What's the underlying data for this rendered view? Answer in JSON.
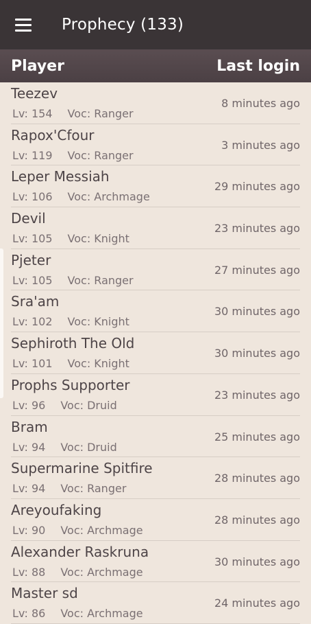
{
  "appbar": {
    "title": "Prophecy (133)",
    "menu_icon": "menu-icon"
  },
  "table": {
    "headers": {
      "player": "Player",
      "last_login": "Last login"
    },
    "rows": [
      {
        "name": "Teezev",
        "level": "Lv: 154",
        "vocation": "Voc: Ranger",
        "last_login": "8 minutes ago"
      },
      {
        "name": "Rapox'Cfour",
        "level": "Lv: 119",
        "vocation": "Voc: Ranger",
        "last_login": "3 minutes ago"
      },
      {
        "name": "Leper Messiah",
        "level": "Lv: 106",
        "vocation": "Voc: Archmage",
        "last_login": "29 minutes ago"
      },
      {
        "name": "Devil",
        "level": "Lv: 105",
        "vocation": "Voc: Knight",
        "last_login": "23 minutes ago"
      },
      {
        "name": "Pjeter",
        "level": "Lv: 105",
        "vocation": "Voc: Ranger",
        "last_login": "27 minutes ago"
      },
      {
        "name": "Sra'am",
        "level": "Lv: 102",
        "vocation": "Voc: Knight",
        "last_login": "30 minutes ago"
      },
      {
        "name": "Sephiroth The Old",
        "level": "Lv: 101",
        "vocation": "Voc: Knight",
        "last_login": "30 minutes ago"
      },
      {
        "name": "Prophs Supporter",
        "level": "Lv: 96",
        "vocation": "Voc: Druid",
        "last_login": "23 minutes ago"
      },
      {
        "name": "Bram",
        "level": "Lv: 94",
        "vocation": "Voc: Druid",
        "last_login": "25 minutes ago"
      },
      {
        "name": "Supermarine Spitfire",
        "level": "Lv: 94",
        "vocation": "Voc: Ranger",
        "last_login": "28 minutes ago"
      },
      {
        "name": "Areyoufaking",
        "level": "Lv: 90",
        "vocation": "Voc: Archmage",
        "last_login": "28 minutes ago"
      },
      {
        "name": "Alexander Raskruna",
        "level": "Lv: 88",
        "vocation": "Voc: Archmage",
        "last_login": "30 minutes ago"
      },
      {
        "name": "Master sd",
        "level": "Lv: 86",
        "vocation": "Voc: Archmage",
        "last_login": "24 minutes ago"
      }
    ]
  },
  "colors": {
    "appbar": "#3a3436",
    "header": "#4f4347",
    "background": "#efe6dd",
    "divider": "#d6cdc5"
  }
}
